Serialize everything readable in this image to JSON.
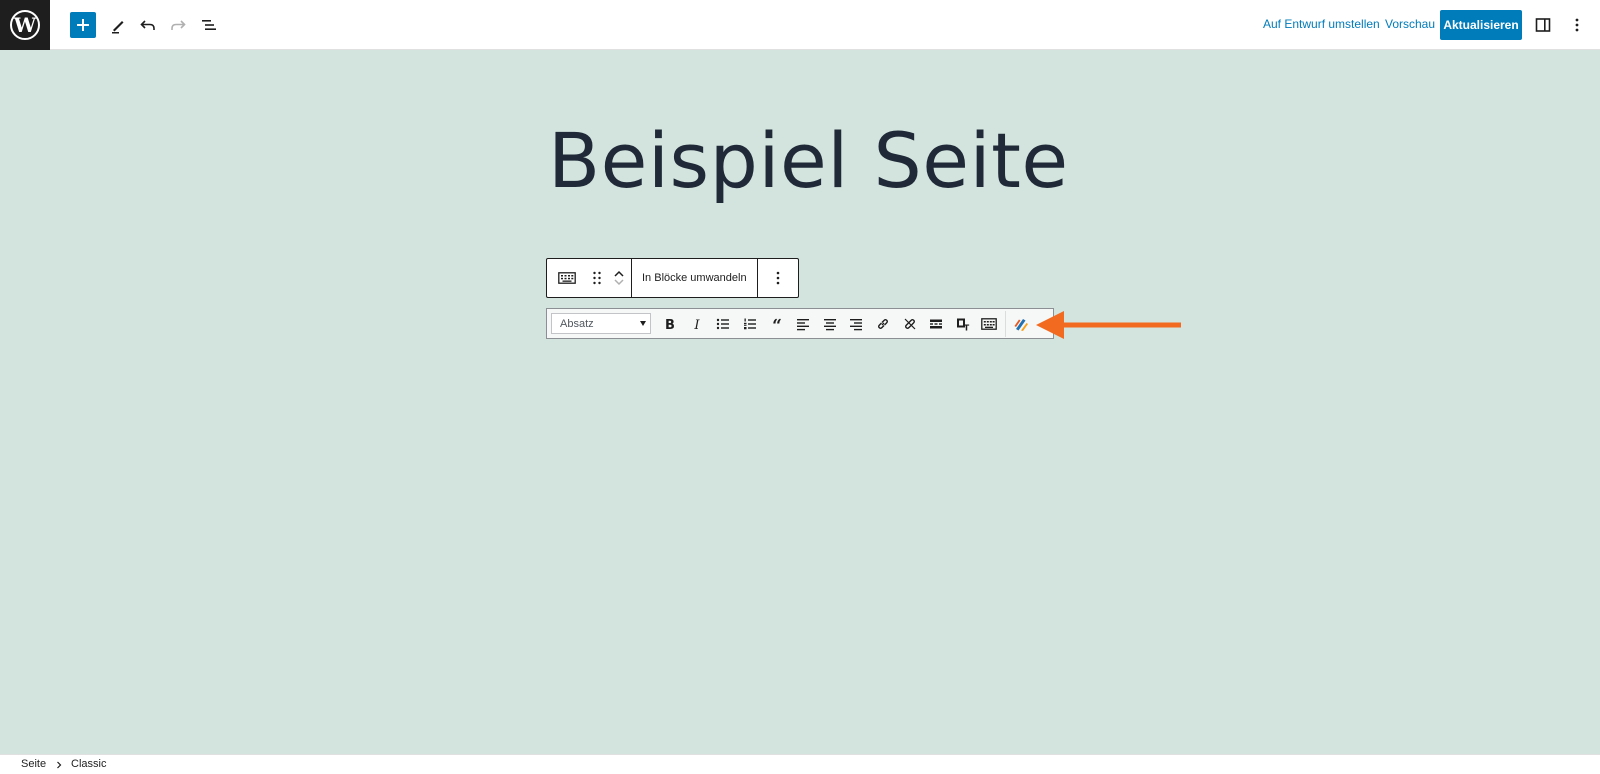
{
  "header": {
    "preview_draft_label": "Auf Entwurf umstellen",
    "preview_label": "Vorschau",
    "update_label": "Aktualisieren",
    "icons": [
      "wordpress-logo-icon",
      "plus-icon",
      "pencil-icon",
      "undo-icon",
      "redo-icon",
      "list-view-icon",
      "sidebar-icon",
      "more-vertical-icon"
    ]
  },
  "editor": {
    "page_title": "Beispiel Seite",
    "block_toolbar": {
      "convert_label": "In Blöcke umwandeln",
      "icons": [
        "keyboard-icon",
        "drag-handle-icon",
        "move-up-icon",
        "move-down-icon",
        "more-options-icon"
      ]
    },
    "classic_toolbar": {
      "format_select": "Absatz",
      "buttons": [
        "bold-icon",
        "italic-icon",
        "bullet-list-icon",
        "numbered-list-icon",
        "blockquote-icon",
        "align-left-icon",
        "align-center-icon",
        "align-right-icon",
        "link-icon",
        "unlink-icon",
        "read-more-icon",
        "paste-text-icon",
        "toolbar-toggle-icon",
        "plugin-icon"
      ]
    },
    "annotation_color": "#f16a1f"
  },
  "footer": {
    "breadcrumb": [
      "Seite",
      "Classic"
    ]
  },
  "colors": {
    "accent": "#007cba",
    "canvas_bg": "#d3e4de",
    "dark": "#1e1e1e"
  }
}
